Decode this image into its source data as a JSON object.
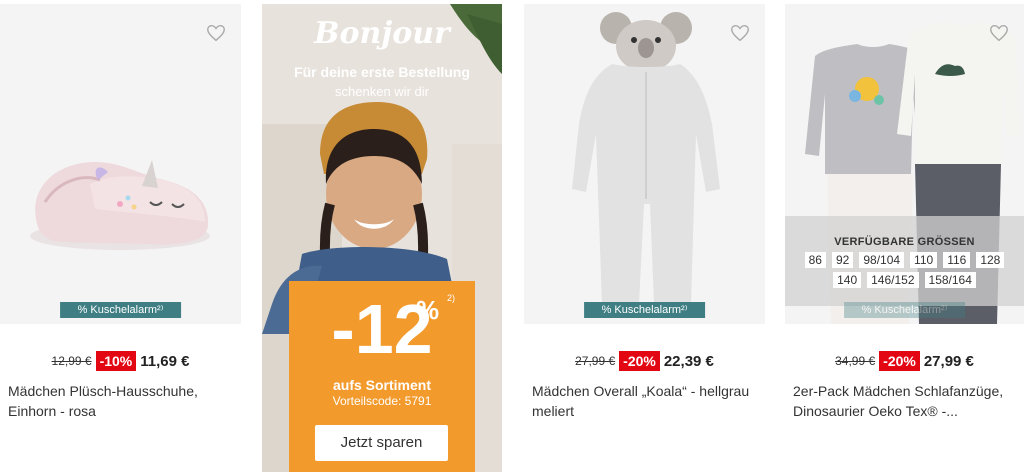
{
  "products": [
    {
      "old_price": "12,99 €",
      "discount": "-10%",
      "new_price": "11,69 €",
      "title": "Mädchen Plüsch-Hausschuhe, Einhorn - rosa",
      "badge": "% Kuschelalarm²⁾",
      "heart_icon": "heart-outline-icon"
    },
    {
      "old_price": "27,99 €",
      "discount": "-20%",
      "new_price": "22,39 €",
      "title": "Mädchen Overall „Koala“ - hellgrau meliert",
      "badge": "% Kuschelalarm²⁾",
      "heart_icon": "heart-outline-icon"
    },
    {
      "old_price": "34,99 €",
      "discount": "-20%",
      "new_price": "27,99 €",
      "title": "2er-Pack Mädchen Schlafanzüge, Dinosaurier Oeko Tex® -...",
      "badge": "% Kuschelalarm²⁾",
      "heart_icon": "heart-outline-icon",
      "sizes_title": "VERFÜGBARE GRÖSSEN",
      "sizes_row1": [
        "86",
        "92",
        "98/104",
        "110",
        "116",
        "128"
      ],
      "sizes_row2": [
        "140",
        "146/152",
        "158/164"
      ]
    }
  ],
  "promo": {
    "headline": "Bonjour",
    "line1": "Für deine erste Bestellung",
    "line2": "schenken wir dir",
    "percent": "-12",
    "percent_sign": "%",
    "footnote": "2)",
    "offer": "aufs Sortiment",
    "code": "Vorteilscode: 5791",
    "cta": "Jetzt sparen"
  },
  "colors": {
    "discount": "#e30613",
    "badge": "#3f7f84",
    "promo_orange": "#f39a2d"
  }
}
